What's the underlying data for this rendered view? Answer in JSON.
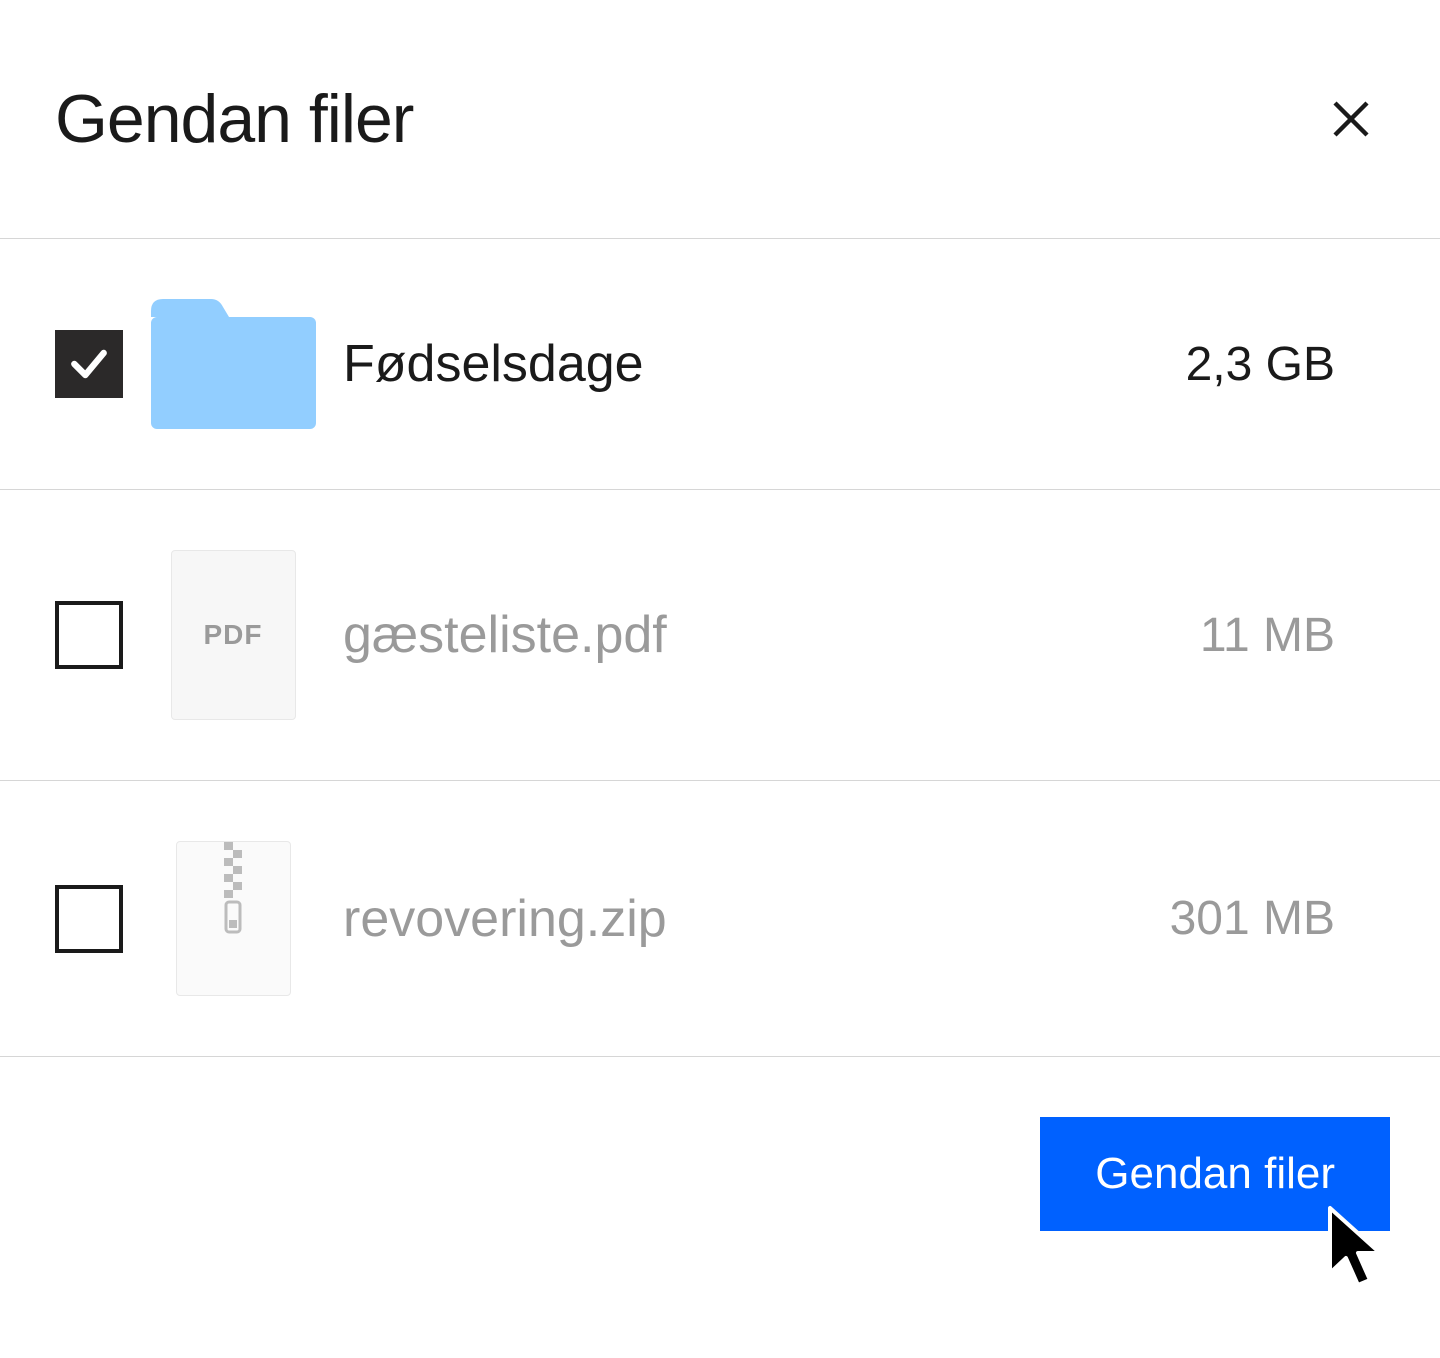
{
  "dialog": {
    "title": "Gendan filer",
    "close_label": "Close"
  },
  "files": [
    {
      "checked": true,
      "type": "folder",
      "name": "Fødselsdage",
      "size": "2,3 GB",
      "dimmed": false
    },
    {
      "checked": false,
      "type": "pdf",
      "name": "gæsteliste.pdf",
      "size": "11 MB",
      "dimmed": true
    },
    {
      "checked": false,
      "type": "zip",
      "name": "revovering.zip",
      "size": "301 MB",
      "dimmed": true
    }
  ],
  "actions": {
    "restore_label": "Gendan filer"
  },
  "icons": {
    "pdf_label": "PDF"
  }
}
